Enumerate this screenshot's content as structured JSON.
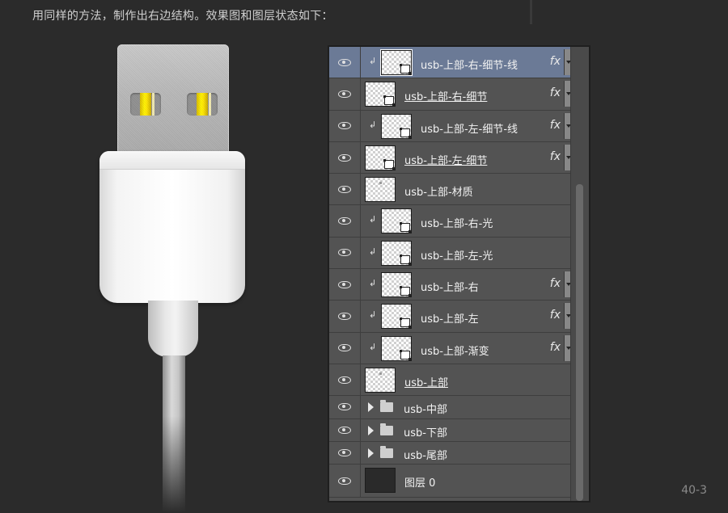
{
  "caption": "用同样的方法，制作出右边结构。效果图和图层状态如下：",
  "page_number": "40-3",
  "layers": [
    {
      "name": "usb-上部-右-细节-线",
      "clipped": true,
      "fx": "fx",
      "underline": false,
      "selected": true
    },
    {
      "name": "usb-上部-右-细节",
      "clipped": false,
      "fx": "fx",
      "underline": true,
      "selected": false
    },
    {
      "name": "usb-上部-左-细节-线",
      "clipped": true,
      "fx": "fx",
      "underline": false,
      "selected": false
    },
    {
      "name": "usb-上部-左-细节",
      "clipped": false,
      "fx": "fx",
      "underline": true,
      "selected": false
    },
    {
      "name": "usb-上部-材质",
      "clipped": false,
      "fx": "",
      "underline": false,
      "selected": false
    },
    {
      "name": "usb-上部-右-光",
      "clipped": true,
      "fx": "",
      "underline": false,
      "selected": false
    },
    {
      "name": "usb-上部-左-光",
      "clipped": true,
      "fx": "",
      "underline": false,
      "selected": false
    },
    {
      "name": "usb-上部-右",
      "clipped": true,
      "fx": "fx",
      "underline": false,
      "selected": false
    },
    {
      "name": "usb-上部-左",
      "clipped": true,
      "fx": "fx",
      "underline": false,
      "selected": false
    },
    {
      "name": "usb-上部-渐变",
      "clipped": true,
      "fx": "fx",
      "underline": false,
      "selected": false
    },
    {
      "name": "usb-上部",
      "clipped": false,
      "fx": "",
      "underline": true,
      "selected": false
    }
  ],
  "folders": [
    {
      "name": "usb-中部"
    },
    {
      "name": "usb-下部"
    },
    {
      "name": "usb-尾部"
    }
  ],
  "background_layer": {
    "name": "图层 0"
  },
  "clip_glyph": "↲",
  "colors": {
    "page_bg": "#2b2b2b",
    "panel_bg": "#535353",
    "selected_row": "#6b7a96",
    "usb_pin_yellow": "#fff200"
  }
}
